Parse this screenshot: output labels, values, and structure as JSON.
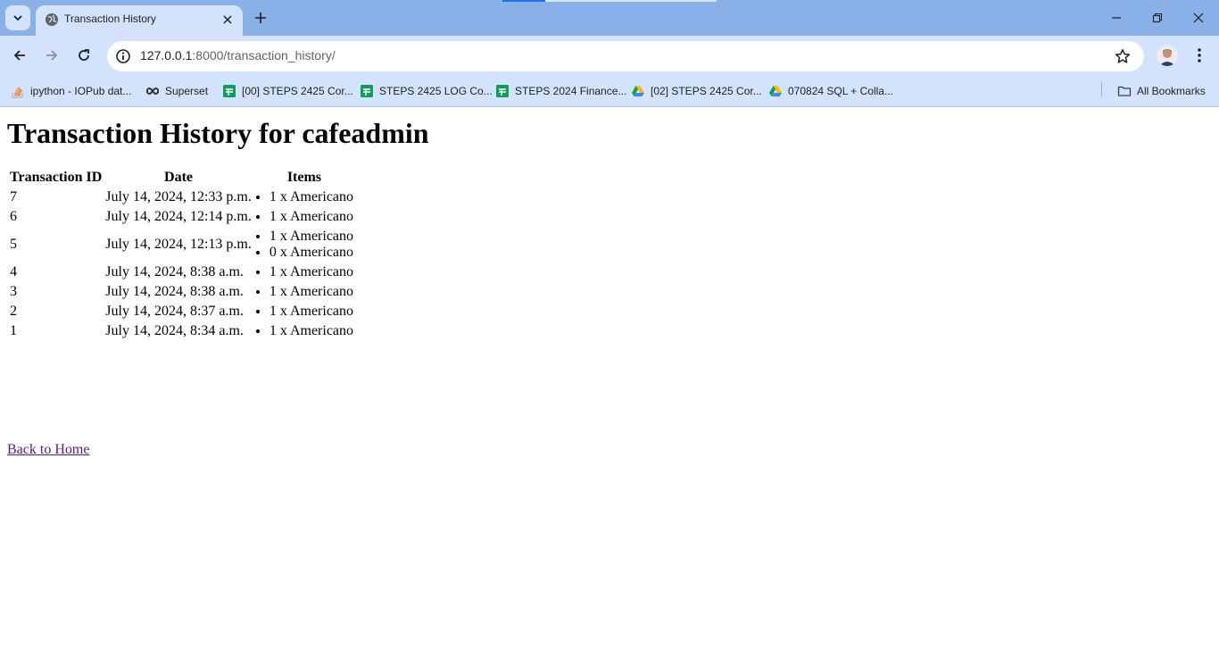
{
  "browser": {
    "tab_title": "Transaction History",
    "url_host": "127.0.0.1",
    "url_rest": ":8000/transaction_history/",
    "bookmarks": [
      {
        "label": "ipython - IOPub dat...",
        "icon": "stack-overflow-icon"
      },
      {
        "label": "Superset",
        "icon": "superset-icon"
      },
      {
        "label": "[00] STEPS 2425 Cor...",
        "icon": "google-sheets-icon"
      },
      {
        "label": "STEPS 2425 LOG Co...",
        "icon": "google-sheets-icon"
      },
      {
        "label": "STEPS 2024 Finance...",
        "icon": "google-sheets-icon"
      },
      {
        "label": "[02] STEPS 2425 Cor...",
        "icon": "google-drive-icon"
      },
      {
        "label": "070824 SQL + Colla...",
        "icon": "google-drive-icon"
      }
    ],
    "all_bookmarks": "All Bookmarks"
  },
  "page": {
    "heading": "Transaction History for cafeadmin",
    "columns": [
      "Transaction ID",
      "Date",
      "Items"
    ],
    "rows": [
      {
        "id": "7",
        "date": "July 14, 2024, 12:33 p.m.",
        "items": [
          "1 x Americano"
        ]
      },
      {
        "id": "6",
        "date": "July 14, 2024, 12:14 p.m.",
        "items": [
          "1 x Americano"
        ]
      },
      {
        "id": "5",
        "date": "July 14, 2024, 12:13 p.m.",
        "items": [
          "1 x Americano",
          "0 x Americano"
        ]
      },
      {
        "id": "4",
        "date": "July 14, 2024, 8:38 a.m.",
        "items": [
          "1 x Americano"
        ]
      },
      {
        "id": "3",
        "date": "July 14, 2024, 8:38 a.m.",
        "items": [
          "1 x Americano"
        ]
      },
      {
        "id": "2",
        "date": "July 14, 2024, 8:37 a.m.",
        "items": [
          "1 x Americano"
        ]
      },
      {
        "id": "1",
        "date": "July 14, 2024, 8:34 a.m.",
        "items": [
          "1 x Americano"
        ]
      }
    ],
    "back_link": "Back to Home"
  }
}
